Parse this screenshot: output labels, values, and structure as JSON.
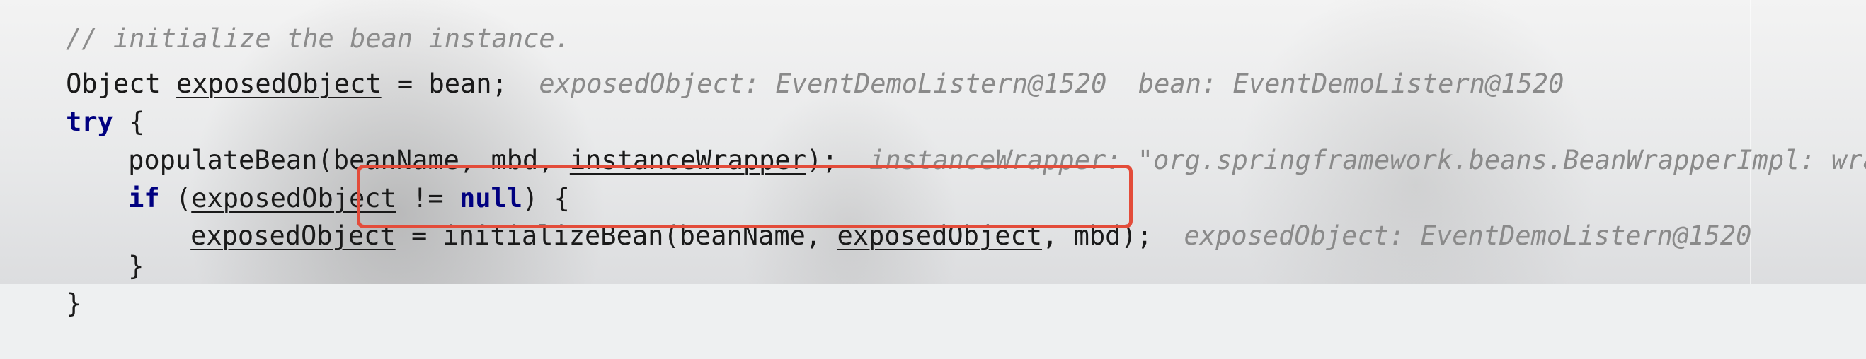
{
  "editor": {
    "lines": {
      "comment": "// initialize the bean instance.",
      "l1": {
        "type": "Object",
        "var": "exposedObject",
        "rest": " = bean;",
        "hint": "exposedObject: EventDemoListern@1520  bean: EventDemoListern@1520"
      },
      "l2": {
        "kw": "try",
        "rest": " {"
      },
      "l3": {
        "call": "populateBean(beanName, mbd, ",
        "arg": "instanceWrapper",
        "rest": ");",
        "hint": "instanceWrapper: \"org.springframework.beans.BeanWrapperImpl: wrapping"
      },
      "l4": {
        "kw": "if",
        "open": " (",
        "var": "exposedObject",
        "op": " != ",
        "nullkw": "null",
        "rest": ") {"
      },
      "l5": {
        "var": "exposedObject",
        "op": " = ",
        "call": "initializeBean(beanName, ",
        "arg": "exposedObject",
        "rest": ", mbd);",
        "hint": "exposedObject: EventDemoListern@1520"
      },
      "l6": "}",
      "l7": "}"
    },
    "highlight_color": "#e34c3a",
    "keyword_color": "#000080",
    "hint_color": "#8a8a8a"
  }
}
